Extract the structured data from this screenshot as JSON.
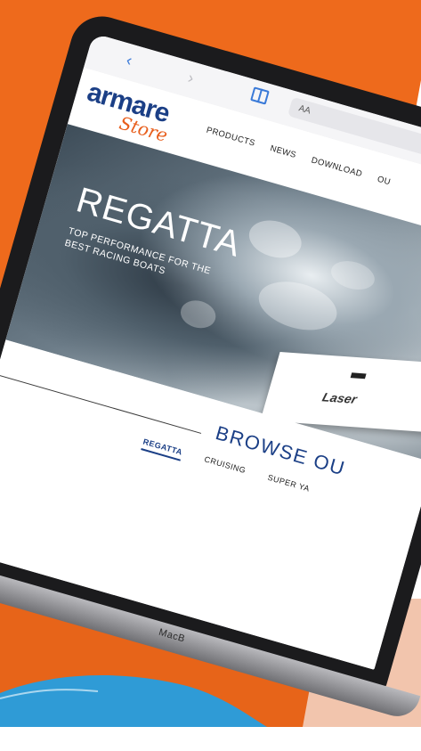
{
  "page": {
    "colors": {
      "orange": "#ee6a1c",
      "navy": "#1b3f86",
      "sky": "#2f9bd6"
    }
  },
  "browser": {
    "back_icon": "chevron-left-icon",
    "forward_icon": "chevron-right-icon",
    "reader_icon": "book-icon",
    "address_text": "AA"
  },
  "site": {
    "logo_main": "armare",
    "logo_sub": "Store",
    "nav": [
      "PRODUCTS",
      "NEWS",
      "DOWNLOAD",
      "OU"
    ]
  },
  "hero": {
    "title": "REGATTA",
    "subtitle": "TOP PERFORMANCE FOR THE BEST RACING BOATS",
    "hull_text": "Laser"
  },
  "browse": {
    "title": "BROWSE OU",
    "categories": [
      "REGATTA",
      "CRUISING",
      "SUPER YA"
    ],
    "active_category": "REGATTA"
  },
  "device": {
    "label": "MacB"
  }
}
